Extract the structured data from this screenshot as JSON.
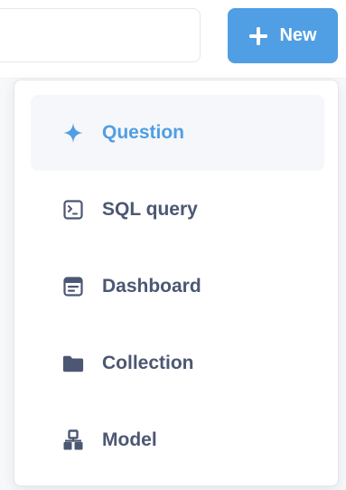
{
  "header": {
    "new_button_label": "New"
  },
  "menu": {
    "items": [
      {
        "label": "Question",
        "icon": "sparkle-icon",
        "active": true
      },
      {
        "label": "SQL query",
        "icon": "sql-terminal-icon",
        "active": false
      },
      {
        "label": "Dashboard",
        "icon": "dashboard-icon",
        "active": false
      },
      {
        "label": "Collection",
        "icon": "folder-icon",
        "active": false
      },
      {
        "label": "Model",
        "icon": "model-icon",
        "active": false
      }
    ]
  },
  "colors": {
    "accent": "#509ee3",
    "text": "#4c5773",
    "active_bg": "#f5f7fb"
  }
}
